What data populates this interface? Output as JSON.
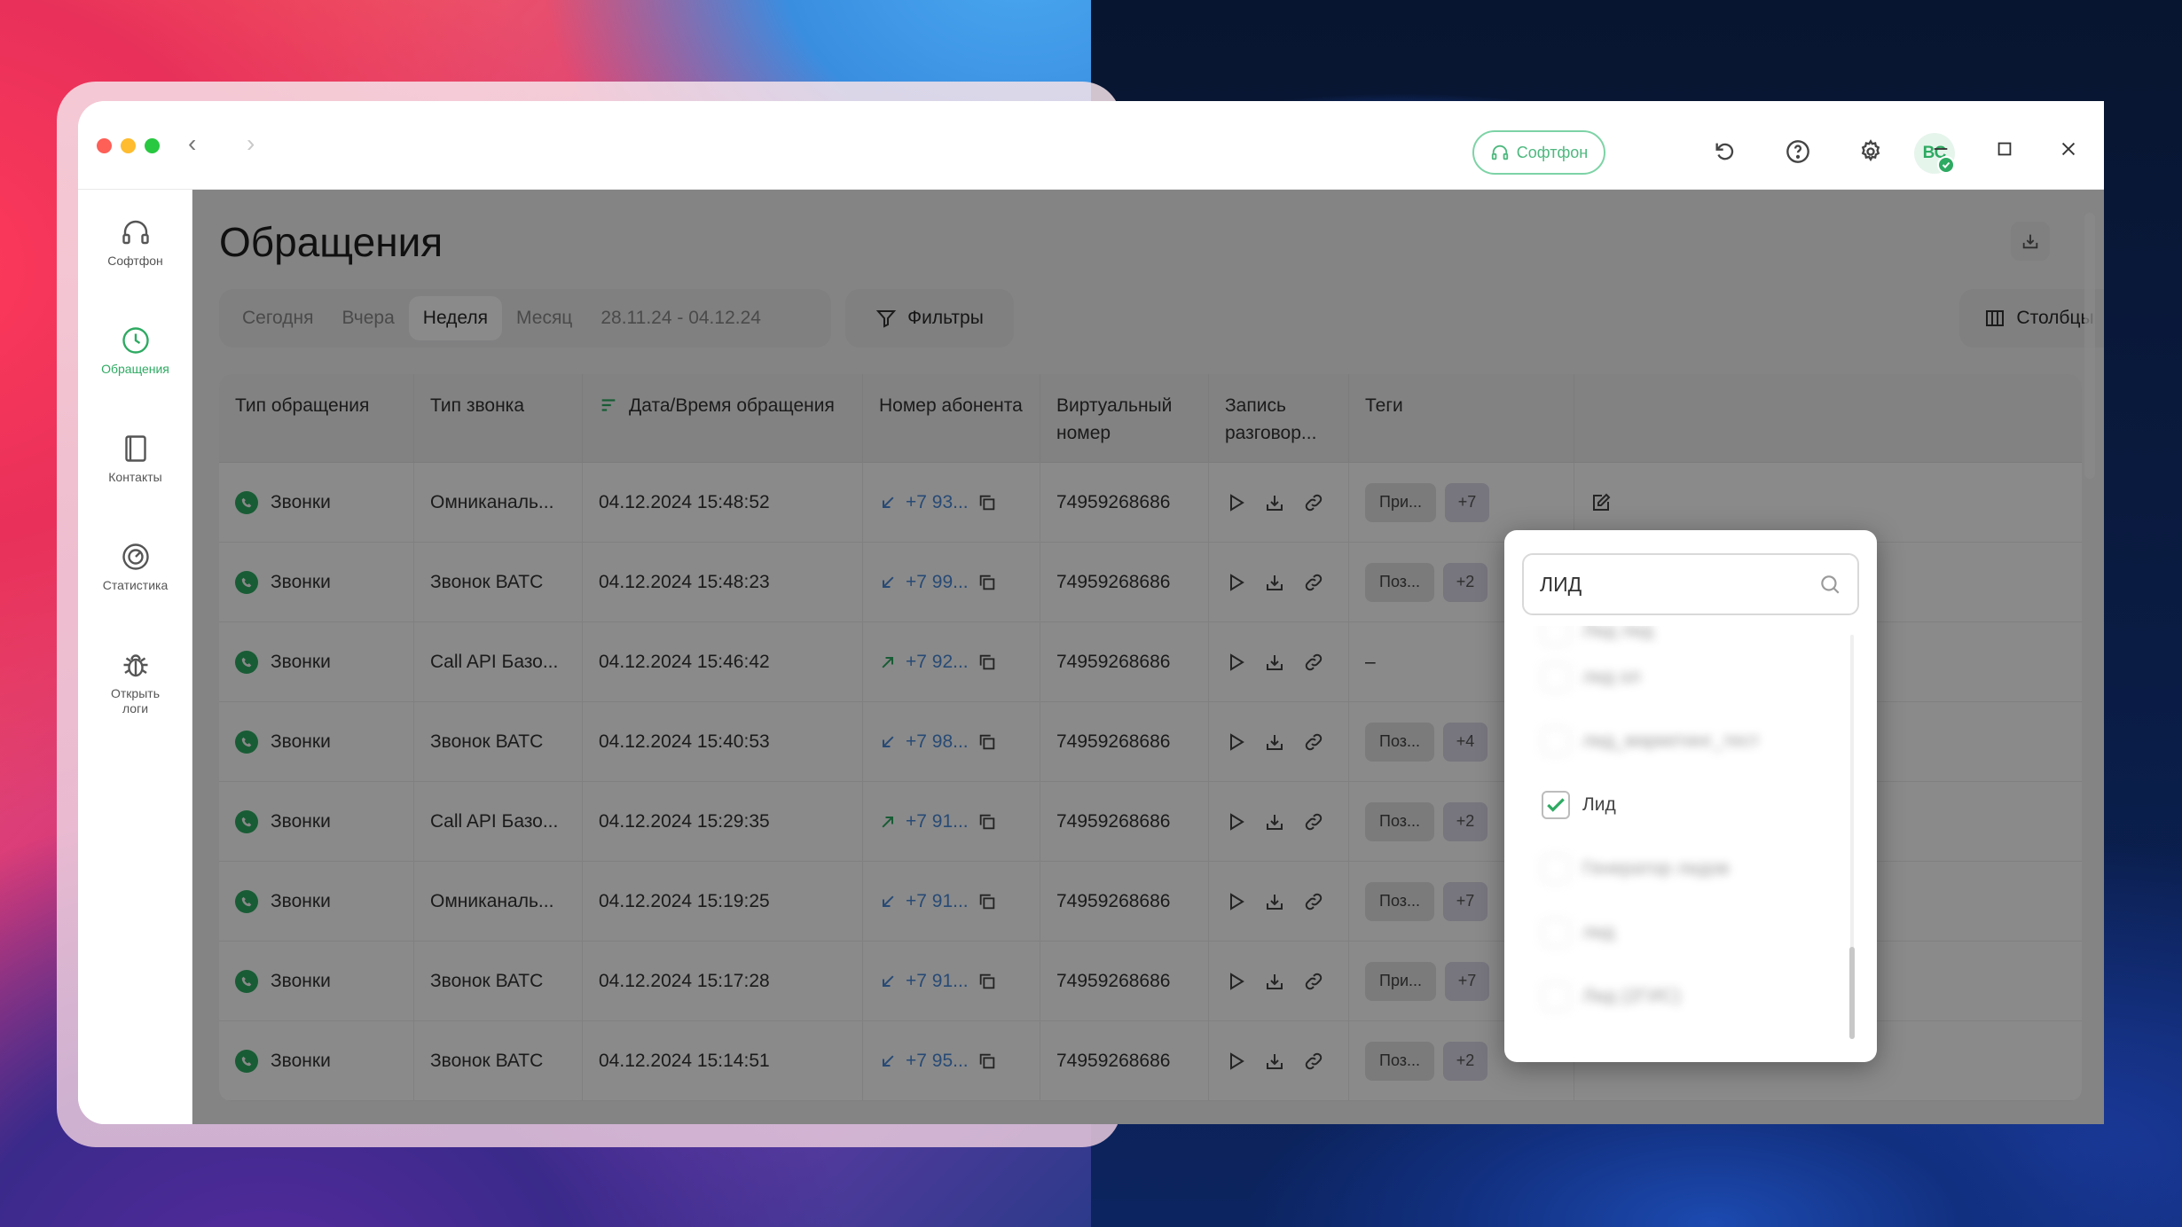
{
  "window": {
    "softphone_label": "Софтфон",
    "avatar_initials": "ВС"
  },
  "sidebar": {
    "items": [
      {
        "label": "Софтфон",
        "icon": "headset-icon"
      },
      {
        "label": "Обращения",
        "icon": "clock-icon"
      },
      {
        "label": "Контакты",
        "icon": "contacts-book-icon"
      },
      {
        "label": "Статистика",
        "icon": "gauge-icon"
      },
      {
        "label": "Открыть логи",
        "icon": "bug-icon"
      }
    ]
  },
  "page": {
    "title": "Обращения",
    "periods": [
      "Сегодня",
      "Вчера",
      "Неделя",
      "Месяц",
      "28.11.24 - 04.12.24"
    ],
    "active_period": "Неделя",
    "filters_label": "Фильтры",
    "columns_label": "Столбцы"
  },
  "table": {
    "headers": [
      "Тип обращения",
      "Тип звонка",
      "Дата/Время обращения",
      "Номер абонента",
      "Виртуальный номер",
      "Запись разговор...",
      "Теги"
    ],
    "rows": [
      {
        "type": "Звонки",
        "call_type": "Омниканаль...",
        "datetime": "04.12.2024 15:48:52",
        "direction": "in",
        "phone": "+7 93...",
        "virtual": "74959268686",
        "tag": "При...",
        "tag_more": "+7"
      },
      {
        "type": "Звонки",
        "call_type": "Звонок ВАТС",
        "datetime": "04.12.2024 15:48:23",
        "direction": "in",
        "phone": "+7 99...",
        "virtual": "74959268686",
        "tag": "Поз...",
        "tag_more": "+2"
      },
      {
        "type": "Звонки",
        "call_type": "Call API Базо...",
        "datetime": "04.12.2024 15:46:42",
        "direction": "out",
        "phone": "+7 92...",
        "virtual": "74959268686",
        "tag": "–",
        "tag_more": ""
      },
      {
        "type": "Звонки",
        "call_type": "Звонок ВАТС",
        "datetime": "04.12.2024 15:40:53",
        "direction": "in",
        "phone": "+7 98...",
        "virtual": "74959268686",
        "tag": "Поз...",
        "tag_more": "+4"
      },
      {
        "type": "Звонки",
        "call_type": "Call API Базо...",
        "datetime": "04.12.2024 15:29:35",
        "direction": "out",
        "phone": "+7 91...",
        "virtual": "74959268686",
        "tag": "Поз...",
        "tag_more": "+2"
      },
      {
        "type": "Звонки",
        "call_type": "Омниканаль...",
        "datetime": "04.12.2024 15:19:25",
        "direction": "in",
        "phone": "+7 91...",
        "virtual": "74959268686",
        "tag": "Поз...",
        "tag_more": "+7"
      },
      {
        "type": "Звонки",
        "call_type": "Звонок ВАТС",
        "datetime": "04.12.2024 15:17:28",
        "direction": "in",
        "phone": "+7 91...",
        "virtual": "74959268686",
        "tag": "При...",
        "tag_more": "+7"
      },
      {
        "type": "Звонки",
        "call_type": "Звонок ВАТС",
        "datetime": "04.12.2024 15:14:51",
        "direction": "in",
        "phone": "+7 95...",
        "virtual": "74959268686",
        "tag": "Поз...",
        "tag_more": "+2"
      }
    ]
  },
  "tag_popup": {
    "search_value": "ЛИД",
    "options": [
      {
        "label": "Лид лид",
        "checked": false,
        "blurred": true
      },
      {
        "label": "лид ол",
        "checked": false,
        "blurred": true
      },
      {
        "label": "лид_маркетинг_тест",
        "checked": false,
        "blurred": true
      },
      {
        "label": "Лид",
        "checked": true,
        "blurred": false
      },
      {
        "label": "Генератор лидов",
        "checked": false,
        "blurred": true
      },
      {
        "label": "лид",
        "checked": false,
        "blurred": true
      },
      {
        "label": "Лид (2ГИС)",
        "checked": false,
        "blurred": true
      }
    ]
  },
  "colors": {
    "accent_green": "#2eaa62",
    "link_blue": "#4a8ad8"
  }
}
